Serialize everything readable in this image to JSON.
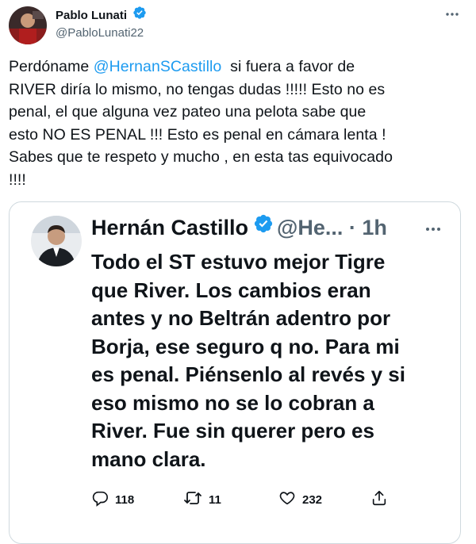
{
  "tweet": {
    "display_name": "Pablo Lunati",
    "handle": "@PabloLunati22",
    "text_before_mention": "Perdóname ",
    "mention": "@HernanSCastillo",
    "text_after_mention": "  si fuera a favor de\nRIVER diría lo mismo, no tengas dudas !!!!! Esto no es\npenal, el que alguna vez pateo una pelota sabe que\nesto NO ES PENAL !!! Esto es penal en cámara lenta !\nSabes que te respeto y mucho , en esta tas equivocado\n!!!!"
  },
  "quoted_tweet": {
    "display_name": "Hernán Castillo",
    "handle": "@He...",
    "separator": " · ",
    "time": "1h",
    "text": "Todo el ST estuvo mejor Tigre\nque River. Los cambios eran\nantes y no Beltrán adentro por\nBorja, ese seguro q no. Para mi\nes penal. Piénsenlo al revés y si\neso mismo no se lo cobran a\nRiver. Fue sin querer pero es\nmano clara.",
    "replies": "118",
    "retweets": "11",
    "likes": "232"
  },
  "icons": {
    "verified": "verified-badge-icon",
    "more": "more-options-icon",
    "reply": "reply-icon",
    "retweet": "retweet-icon",
    "like": "heart-icon",
    "share": "share-icon"
  },
  "colors": {
    "accent": "#1d9bf0",
    "text": "#0f1419",
    "secondary": "#536471",
    "border": "#cfd9de"
  }
}
